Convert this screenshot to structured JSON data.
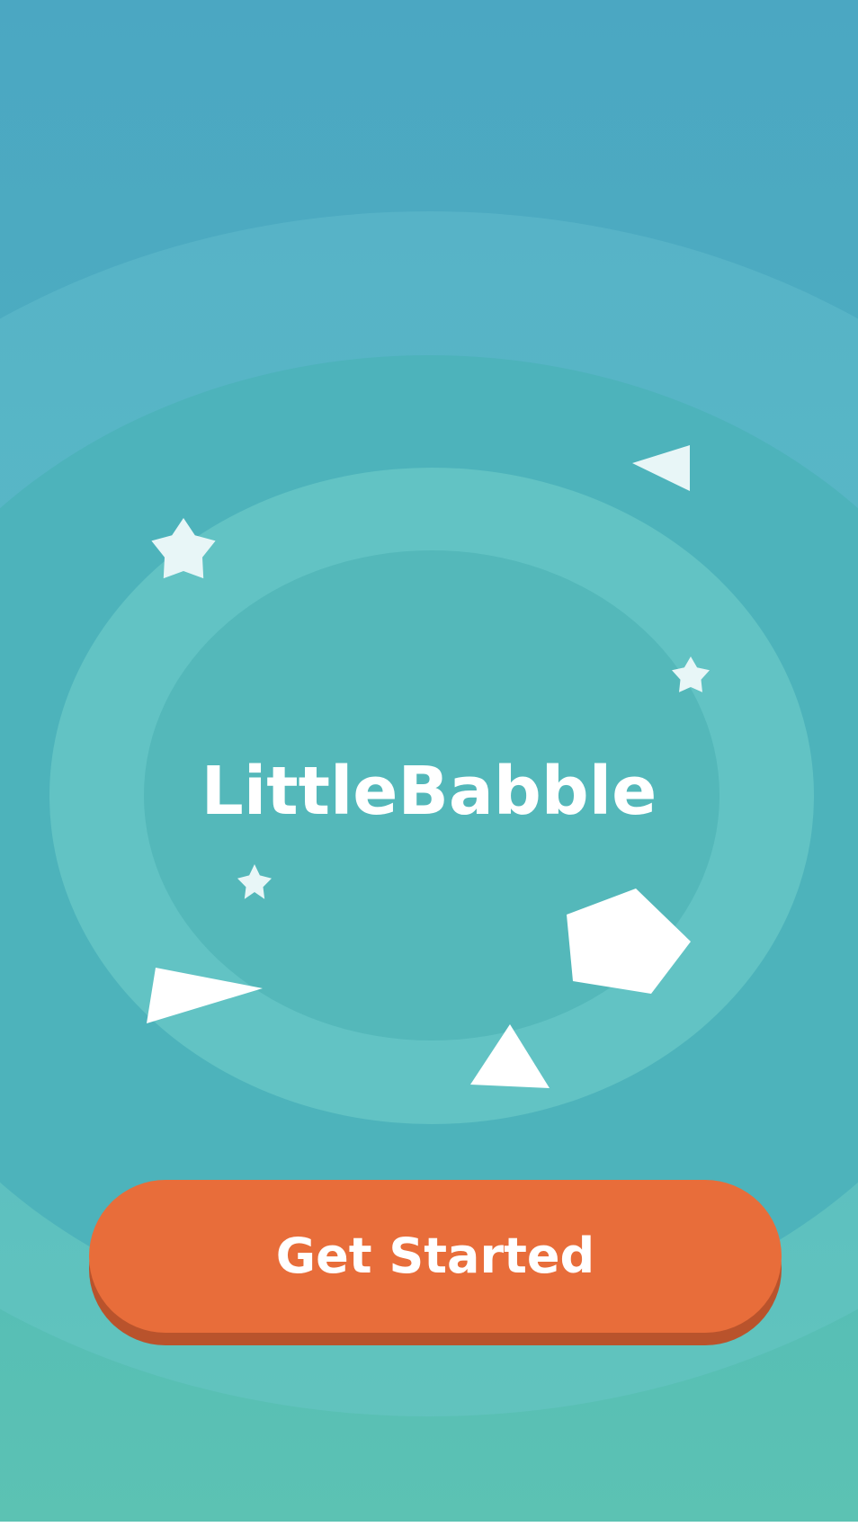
{
  "app": {
    "title": "LittleBabble"
  },
  "actions": {
    "get_started_label": "Get Started"
  },
  "colors": {
    "background_top": "#4ba7c2",
    "background_bottom": "#5cc2b3",
    "accent": "#e86d3a",
    "shape_fill": "#ffffff"
  },
  "decorations": {
    "icons": [
      "star-icon",
      "triangle-icon",
      "pentagon-icon"
    ]
  }
}
